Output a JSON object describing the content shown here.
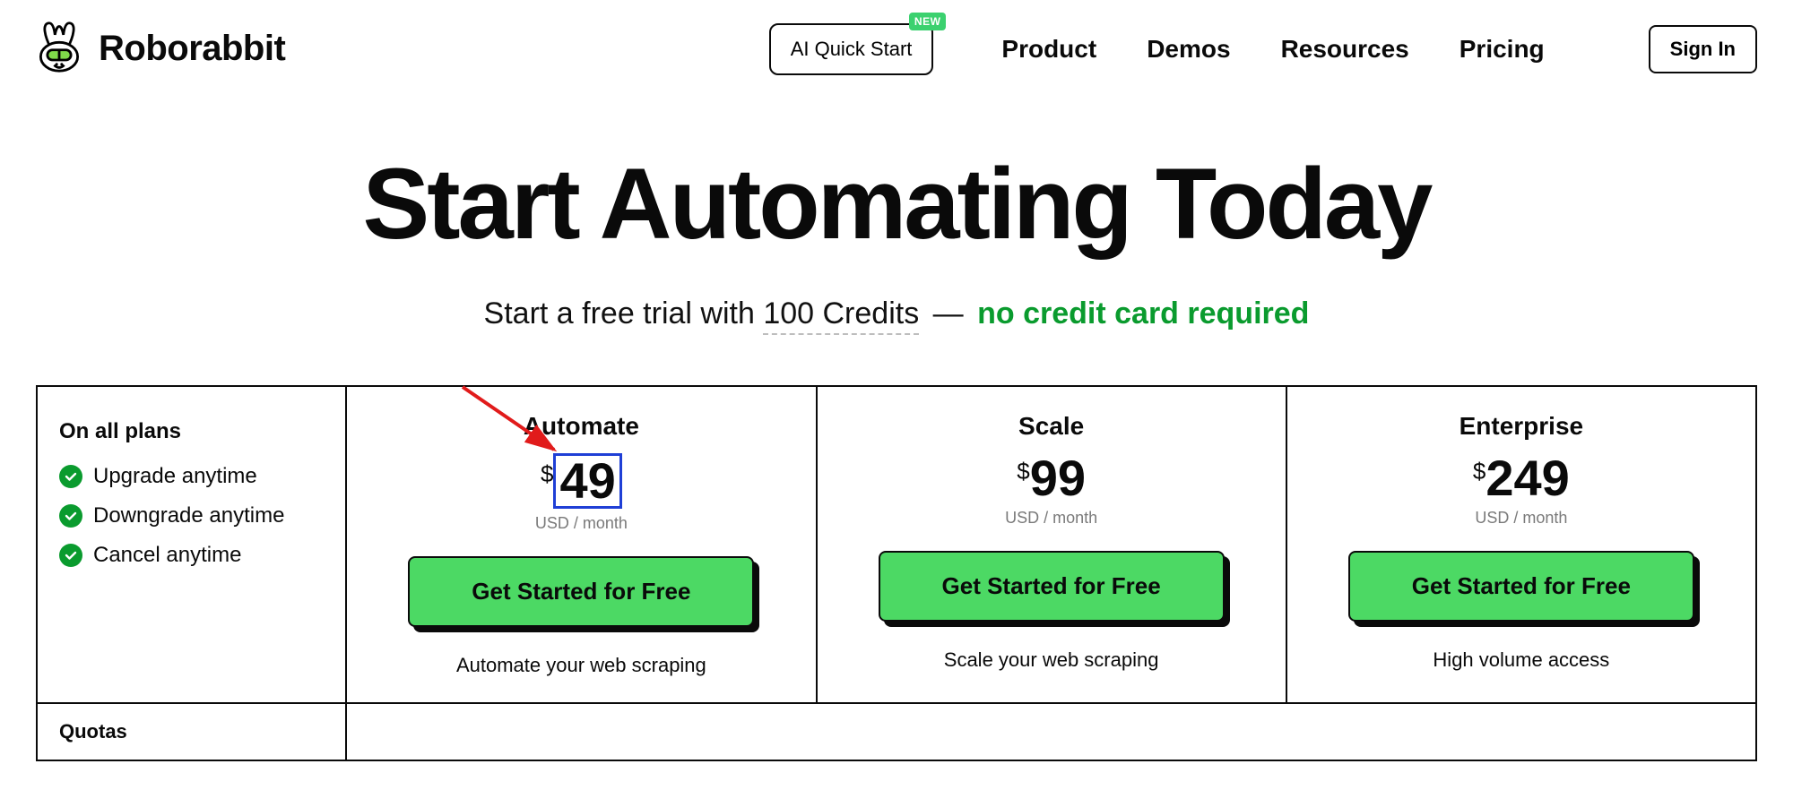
{
  "brand": {
    "name": "Roborabbit"
  },
  "nav": {
    "quick_start": "AI Quick Start",
    "quick_start_badge": "NEW",
    "links": [
      "Product",
      "Demos",
      "Resources",
      "Pricing"
    ],
    "sign_in": "Sign In"
  },
  "hero": {
    "title": "Start Automating Today",
    "sub_prefix": "Start a free trial with ",
    "credits": "100 Credits",
    "dash": " — ",
    "no_cc": "no credit card required"
  },
  "side": {
    "title": "On all plans",
    "benefits": [
      "Upgrade anytime",
      "Downgrade anytime",
      "Cancel anytime"
    ]
  },
  "plans": [
    {
      "name": "Automate",
      "currency": "$",
      "price": "49",
      "unit": "USD / month",
      "cta": "Get Started for Free",
      "desc": "Automate your web scraping",
      "highlight": true
    },
    {
      "name": "Scale",
      "currency": "$",
      "price": "99",
      "unit": "USD / month",
      "cta": "Get Started for Free",
      "desc": "Scale your web scraping",
      "highlight": false
    },
    {
      "name": "Enterprise",
      "currency": "$",
      "price": "249",
      "unit": "USD / month",
      "cta": "Get Started for Free",
      "desc": "High volume access",
      "highlight": false
    }
  ],
  "quotas_label": "Quotas",
  "annotation": {
    "arrow_color": "#e11b1b",
    "highlight_border": "#1f3fd6"
  }
}
